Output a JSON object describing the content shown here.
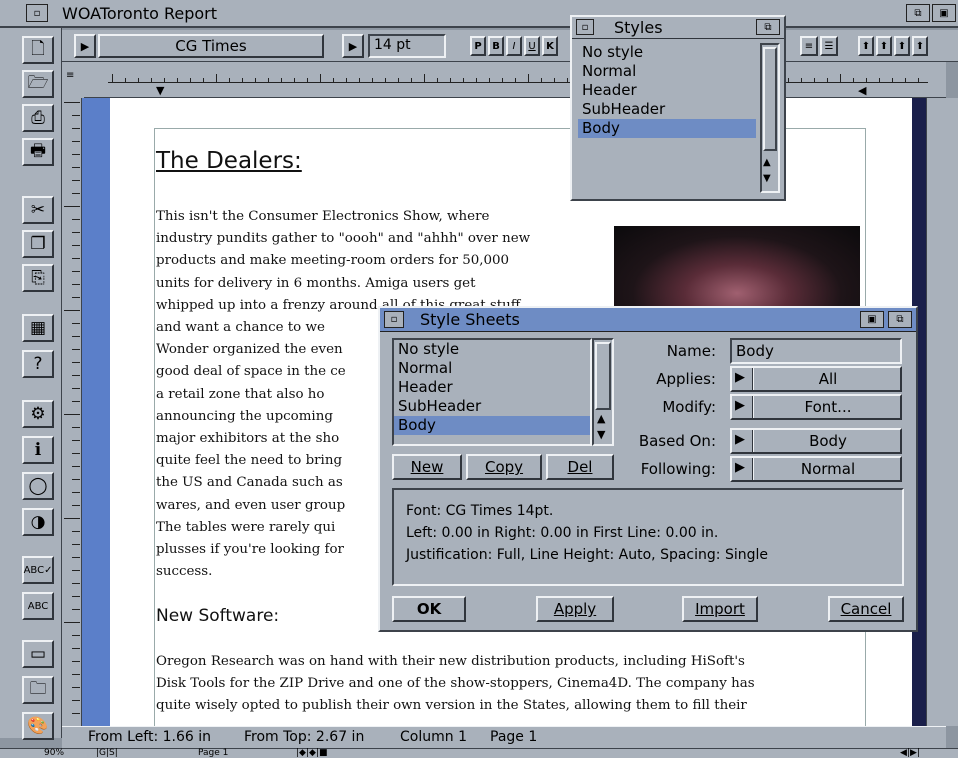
{
  "window": {
    "title": "WOAToronto Report"
  },
  "toolbar": {
    "font": "CG Times",
    "size": "14 pt",
    "style_buttons": [
      "P",
      "B",
      "I",
      "U",
      "K"
    ]
  },
  "document": {
    "heading": "The Dealers:",
    "para1_lines": [
      "This isn't the Consumer Electronics Show, where",
      "industry pundits gather to \"oooh\" and \"ahhh\" over new",
      "products and make meeting-room orders for 50,000",
      "units for delivery in 6 months.  Amiga users get",
      "whipped up into a frenzy around all of this great stuff",
      "and want a chance to we",
      "Wonder organized the even",
      "good deal of space in the ce",
      "a retail zone that also ho",
      "announcing the upcoming",
      "major exhibitors at the sho",
      "quite feel the need to bring",
      "the US and Canada such as",
      "wares, and even user group",
      "The tables were rarely qui",
      "plusses if you're looking for",
      "success."
    ],
    "subheading": "New Software:",
    "para2_lines": [
      "Oregon Research was on hand with their new distribution products, including HiSoft's",
      "Disk Tools for the ZIP Drive and one of the show-stoppers, Cinema4D.  The company has",
      "quite wisely opted to publish their own version in the States, allowing them to fill their"
    ]
  },
  "styles_panel": {
    "title": "Styles",
    "items": [
      "No style",
      "Normal",
      "Header",
      "SubHeader",
      "Body"
    ],
    "selected": "Body"
  },
  "style_sheets_dialog": {
    "title": "Style Sheets",
    "items": [
      "No style",
      "Normal",
      "Header",
      "SubHeader",
      "Body"
    ],
    "selected": "Body",
    "buttons": {
      "new": "New",
      "copy": "Copy",
      "del": "Del",
      "ok": "OK",
      "apply": "Apply",
      "import": "Import",
      "cancel": "Cancel"
    },
    "fields": {
      "name_label": "Name:",
      "name_value": "Body",
      "applies_label": "Applies:",
      "applies_value": "All",
      "modify_label": "Modify:",
      "modify_value": "Font...",
      "based_on_label": "Based On:",
      "based_on_value": "Body",
      "following_label": "Following:",
      "following_value": "Normal"
    },
    "info_lines": [
      "Font: CG Times 14pt.",
      "Left: 0.00 in  Right: 0.00 in  First Line: 0.00 in.",
      "Justification: Full, Line Height: Auto, Spacing: Single"
    ]
  },
  "status": {
    "from_left": "From Left: 1.66 in",
    "from_top": "From Top: 2.67 in",
    "column": "Column 1",
    "page": "Page 1",
    "zoom": "90%",
    "page_small": "Page 1"
  },
  "colors": {
    "accent": "#6e8cc4",
    "panel": "#a9b1bb",
    "page": "#ffffff",
    "margin": "#5b7fc9"
  }
}
